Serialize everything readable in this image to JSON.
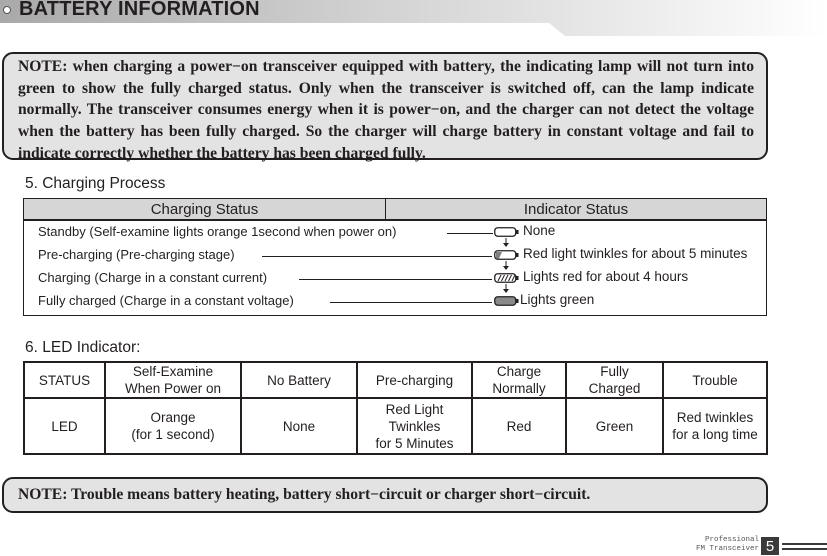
{
  "header": {
    "title": "BATTERY INFORMATION",
    "icon": "bullet-circle-icon"
  },
  "note_top": {
    "text": "NOTE: when charging a power−on transceiver equipped with battery, the indicating lamp will not turn into green to show the fully charged status. Only when the transceiver is switched off, can the lamp indicate normally. The transceiver consumes energy when it is power−on, and the charger can not detect the voltage when the battery has been fully charged. So the charger will charge battery in constant voltage and fail to indicate correctly whether the battery has been charged fully."
  },
  "charging_process": {
    "title": "5. Charging Process",
    "headers": [
      "Charging Status",
      "Indicator Status"
    ],
    "rows": [
      {
        "status": "Standby (Self-examine lights orange 1second when power on)",
        "indicator_icon": "battery-empty-icon",
        "indicator": "None"
      },
      {
        "status": "Pre-charging (Pre-charging stage)",
        "indicator_icon": "battery-low-icon",
        "indicator": "Red light twinkles for about 5 minutes"
      },
      {
        "status": "Charging (Charge in a constant current)",
        "indicator_icon": "battery-charging-icon",
        "indicator": "Lights red for about 4 hours"
      },
      {
        "status": "Fully charged (Charge in a constant voltage)",
        "indicator_icon": "battery-full-icon",
        "indicator": "Lights green"
      }
    ]
  },
  "led_indicator": {
    "title": "6. LED Indicator:",
    "status_row": {
      "label": "STATUS",
      "cells": [
        [
          "Self-Examine",
          "When Power on"
        ],
        [
          "No Battery"
        ],
        [
          "Pre-charging"
        ],
        [
          "Charge",
          "Normally"
        ],
        [
          "Fully",
          "Charged"
        ],
        [
          "Trouble"
        ]
      ]
    },
    "led_row": {
      "label": "LED",
      "cells": [
        [
          "Orange",
          "(for 1 second)"
        ],
        [
          "None"
        ],
        [
          "Red Light",
          "Twinkles",
          "for 5 Minutes"
        ],
        [
          "Red"
        ],
        [
          "Green"
        ],
        [
          "Red twinkles",
          "for a long time"
        ]
      ]
    }
  },
  "note_bottom": {
    "text": "NOTE: Trouble means battery heating, battery short−circuit or charger short−circuit."
  },
  "footer": {
    "line1": "Professional",
    "line2": "FM Transceiver",
    "page_number": "5"
  }
}
